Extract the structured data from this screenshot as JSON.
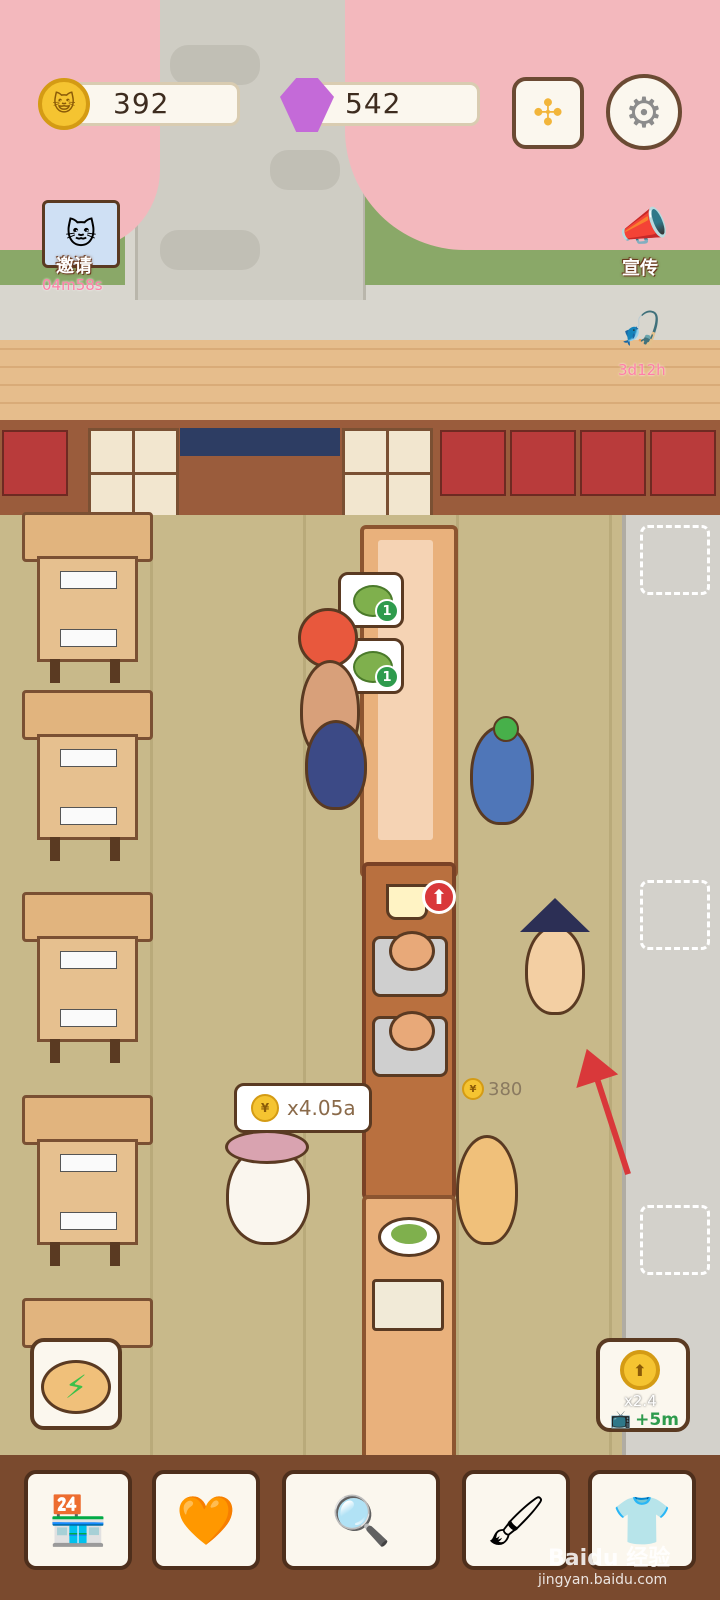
{
  "hud": {
    "coins": "392",
    "gems": "542",
    "coin_icon": "cat-coin-icon",
    "gem_icon": "purple-gem-icon",
    "collapse_icon": "collapse-arrows-icon",
    "settings_icon": "gear-icon"
  },
  "side_buttons": {
    "invite_label": "邀请",
    "invite_timer": "04m58s",
    "promo_label": "宣传",
    "fishing_timer": "3d12h"
  },
  "orders": {
    "bubble_1_count": "1",
    "bubble_2_count": "1"
  },
  "customer_bubble": {
    "multiplier": "x4.05a"
  },
  "floor_coin": {
    "value": "380"
  },
  "boost_button": {
    "multiplier": "x2.4",
    "duration": "+5m"
  },
  "bottom_nav": [
    {
      "name": "shop",
      "icon": "shop-icon"
    },
    {
      "name": "cats",
      "icon": "paw-heart-icon"
    },
    {
      "name": "recipes",
      "icon": "magnifier-newspaper-icon"
    },
    {
      "name": "upgrade",
      "icon": "paint-roller-icon"
    },
    {
      "name": "outfits",
      "icon": "tshirt-icon"
    }
  ],
  "watermark": {
    "text": "Baidu 经验",
    "url": "jingyan.baidu.com"
  },
  "colors": {
    "coin": "#f5c431",
    "gem": "#c46ad8",
    "accent_red": "#d9383a",
    "timer_pink": "#ff7fa8"
  }
}
